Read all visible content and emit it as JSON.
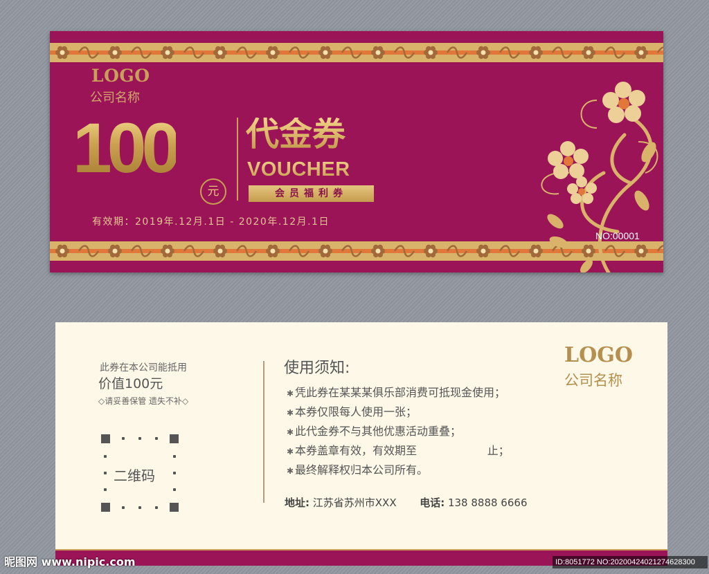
{
  "front": {
    "logo": "LOGO",
    "company_name": "公司名称",
    "amount": "100",
    "amount_unit": "元",
    "title_cn": "代金券",
    "title_en": "VOUCHER",
    "member_label": "会员福利券",
    "validity": "有效期：2019年.12月.1日 - 2020年.12月.1日",
    "serial_no": "NO:00001"
  },
  "back": {
    "intro_line1": "此券在本公司能抵用",
    "intro_line2": "价值100元",
    "intro_line3": "◇请妥善保管 遗失不补◇",
    "qr_label": "二维码",
    "rules_title": "使用须知:",
    "rules": [
      "凭此券在某某某俱乐部消费可抵现金使用；",
      "本券仅限每人使用一张；",
      "此代金券不与其他优惠活动重叠；",
      "本券盖章有效，有效期至                    止；",
      "最终解释权归本公司所有。"
    ],
    "address_label": "地址:",
    "address_value": "江苏省苏州市XXX",
    "phone_label": "电话:",
    "phone_value": "138 8888 6666",
    "logo": "LOGO",
    "company_name": "公司名称"
  },
  "watermark": {
    "site": "昵图网 www.nipic.com",
    "id_text": "ID:8051772 NO:20200424021274628300"
  },
  "colors": {
    "magenta": "#9b1457",
    "gold": "#c9a05a",
    "cream": "#fdf8e7"
  }
}
